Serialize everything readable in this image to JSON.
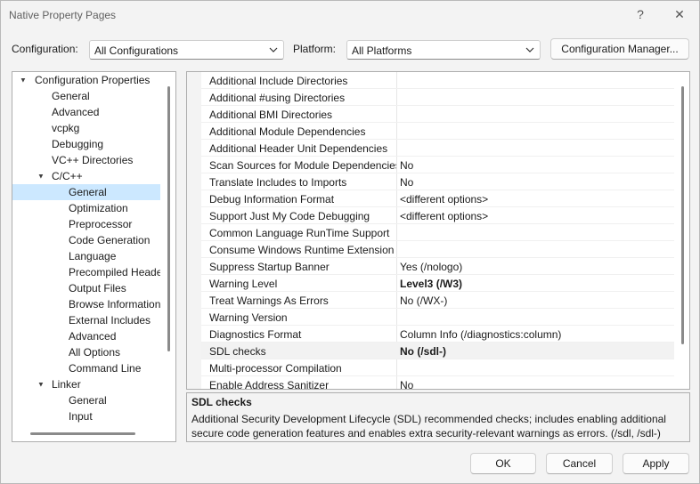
{
  "window": {
    "title": "Native Property Pages",
    "help_glyph": "?",
    "close_glyph": "✕"
  },
  "toolbar": {
    "configuration_label": "Configuration:",
    "configuration_value": "All Configurations",
    "platform_label": "Platform:",
    "platform_value": "All Platforms",
    "config_manager_label": "Configuration Manager..."
  },
  "tree": {
    "items": [
      {
        "label": "Configuration Properties",
        "arrow": "▲"
      },
      {
        "label": "General"
      },
      {
        "label": "Advanced"
      },
      {
        "label": "vcpkg"
      },
      {
        "label": "Debugging"
      },
      {
        "label": "VC++ Directories"
      },
      {
        "label": "C/C++",
        "arrow": "▲"
      },
      {
        "label": "General"
      },
      {
        "label": "Optimization"
      },
      {
        "label": "Preprocessor"
      },
      {
        "label": "Code Generation"
      },
      {
        "label": "Language"
      },
      {
        "label": "Precompiled Heade"
      },
      {
        "label": "Output Files"
      },
      {
        "label": "Browse Information"
      },
      {
        "label": "External Includes"
      },
      {
        "label": "Advanced"
      },
      {
        "label": "All Options"
      },
      {
        "label": "Command Line"
      },
      {
        "label": "Linker",
        "arrow": "▲"
      },
      {
        "label": "General"
      },
      {
        "label": "Input"
      }
    ]
  },
  "properties": {
    "rows": [
      {
        "name": "Additional Include Directories",
        "value": ""
      },
      {
        "name": "Additional #using Directories",
        "value": ""
      },
      {
        "name": "Additional BMI Directories",
        "value": ""
      },
      {
        "name": "Additional Module Dependencies",
        "value": ""
      },
      {
        "name": "Additional Header Unit Dependencies",
        "value": ""
      },
      {
        "name": "Scan Sources for Module Dependencies",
        "value": "No"
      },
      {
        "name": "Translate Includes to Imports",
        "value": "No"
      },
      {
        "name": "Debug Information Format",
        "value": "<different options>"
      },
      {
        "name": "Support Just My Code Debugging",
        "value": "<different options>"
      },
      {
        "name": "Common Language RunTime Support",
        "value": ""
      },
      {
        "name": "Consume Windows Runtime Extension",
        "value": ""
      },
      {
        "name": "Suppress Startup Banner",
        "value": "Yes (/nologo)"
      },
      {
        "name": "Warning Level",
        "value": "Level3 (/W3)"
      },
      {
        "name": "Treat Warnings As Errors",
        "value": "No (/WX-)"
      },
      {
        "name": "Warning Version",
        "value": ""
      },
      {
        "name": "Diagnostics Format",
        "value": "Column Info (/diagnostics:column)"
      },
      {
        "name": "SDL checks",
        "value": "No (/sdl-)"
      },
      {
        "name": "Multi-processor Compilation",
        "value": ""
      },
      {
        "name": "Enable Address Sanitizer",
        "value": "No"
      }
    ]
  },
  "description": {
    "title": "SDL checks",
    "text": "Additional Security Development Lifecycle (SDL) recommended checks; includes enabling additional secure code generation features and enables extra security-relevant warnings as errors.     (/sdl, /sdl-)"
  },
  "buttons": {
    "ok": "OK",
    "cancel": "Cancel",
    "apply": "Apply"
  }
}
